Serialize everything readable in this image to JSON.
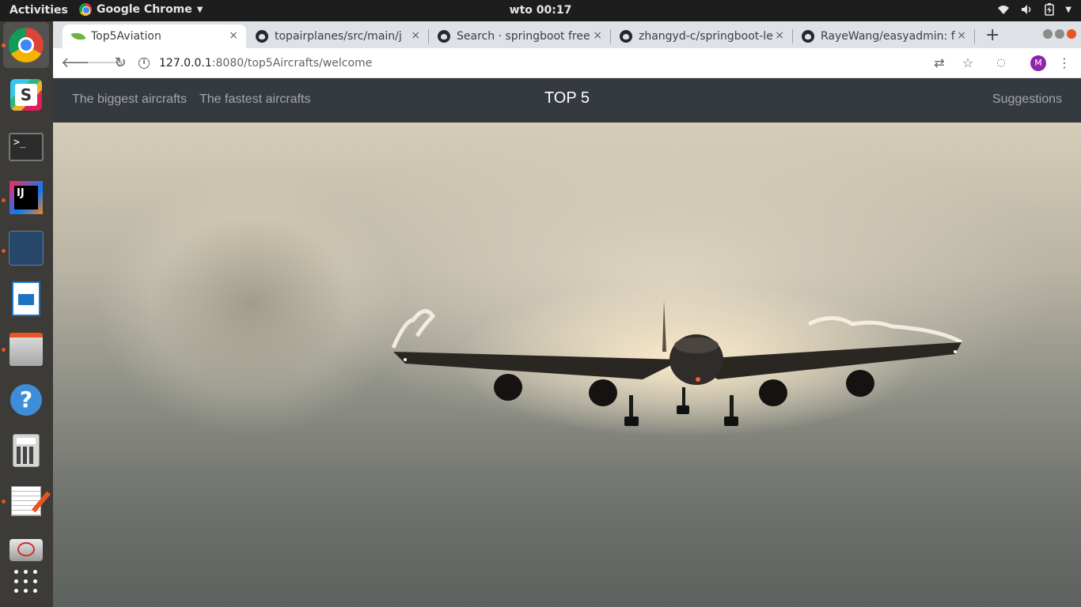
{
  "topbar": {
    "activities": "Activities",
    "app_name": "Google Chrome",
    "clock": "wto 00:17"
  },
  "dock": {
    "items": [
      "chrome-icon",
      "slack-icon",
      "terminal-icon",
      "intellij-icon",
      "mysql-workbench-icon",
      "libreoffice-writer-icon",
      "file-cabinet-icon",
      "help-icon",
      "calculator-icon",
      "text-editor-icon",
      "remmina-icon",
      "show-apps-icon"
    ]
  },
  "browser": {
    "tabs": [
      {
        "title": "Top5Aviation",
        "icon": "spring-leaf-icon",
        "active": true
      },
      {
        "title": "topairplanes/src/main/j",
        "icon": "github-icon",
        "active": false
      },
      {
        "title": "Search · springboot free",
        "icon": "github-icon",
        "active": false
      },
      {
        "title": "zhangyd-c/springboot-le",
        "icon": "github-icon",
        "active": false
      },
      {
        "title": "RayeWang/easyadmin: f",
        "icon": "github-icon",
        "active": false
      }
    ],
    "new_tab": "+",
    "url_host": "127.0.0.1",
    "url_path": ":8080/top5Aircrafts/welcome",
    "avatar_letter": "M",
    "close_label": "×"
  },
  "site": {
    "nav_left": [
      "The biggest aircrafts",
      "The fastest aircrafts"
    ],
    "brand": "TOP 5",
    "nav_right": "Suggestions"
  },
  "colors": {
    "navbar": "#343a40",
    "accent": "#e95420",
    "avatar": "#8e24aa"
  }
}
